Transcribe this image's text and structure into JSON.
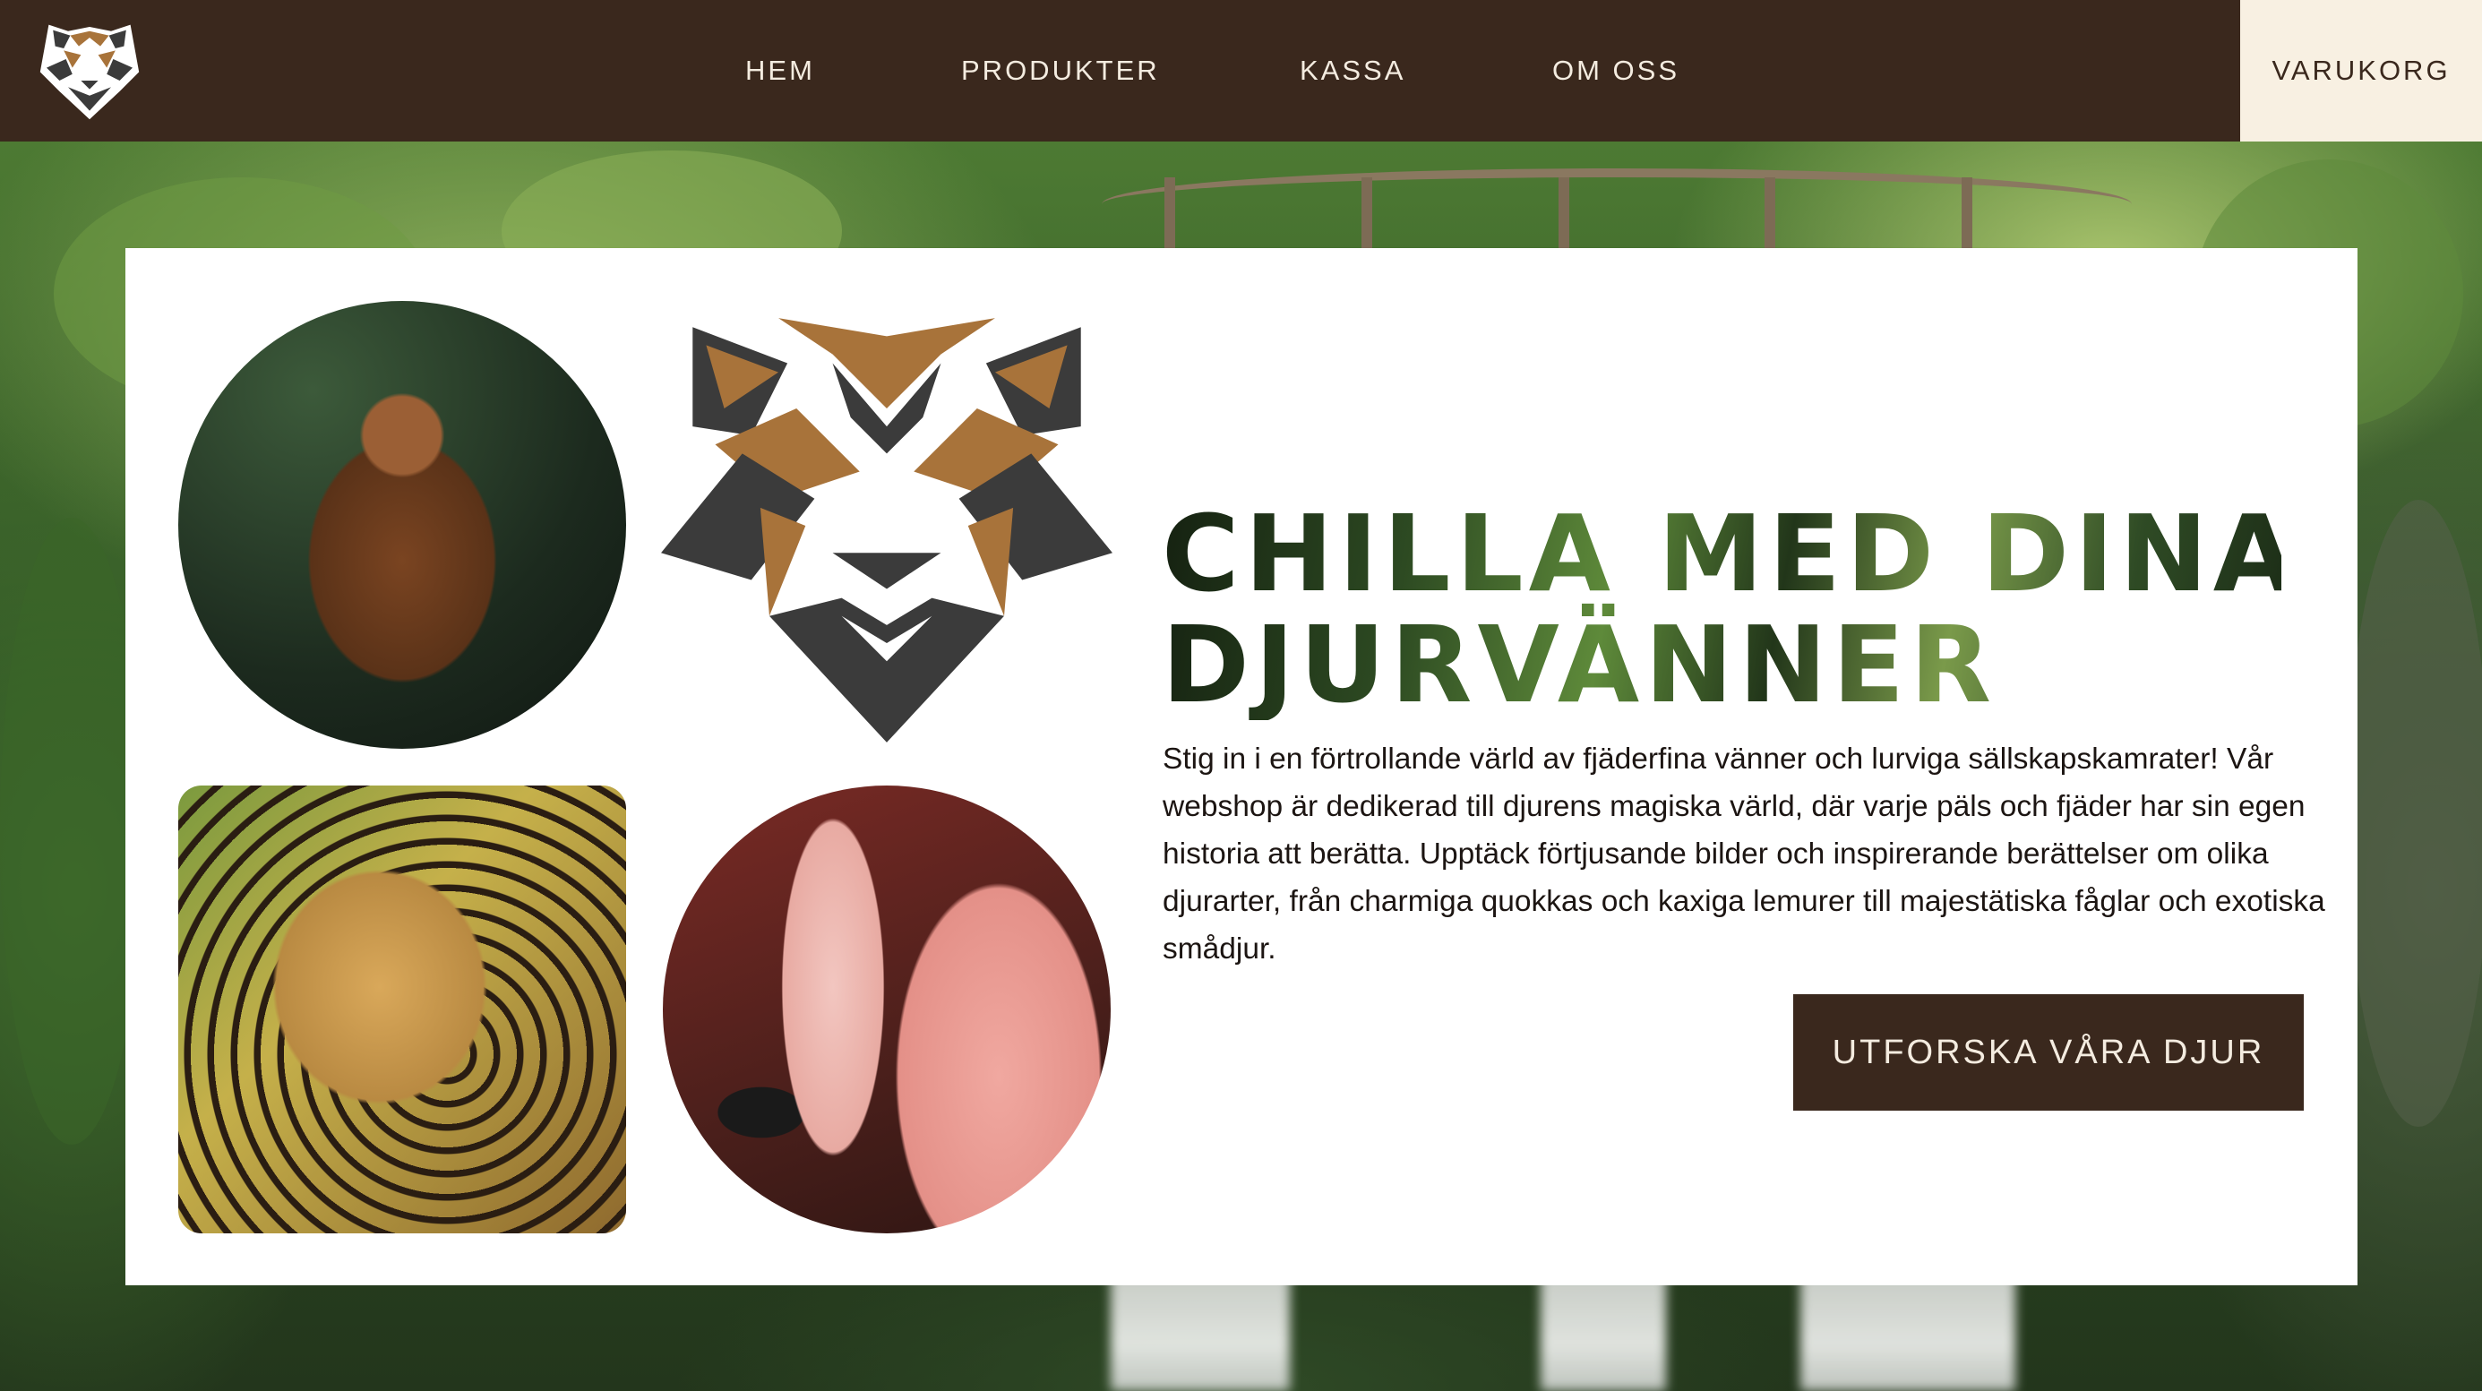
{
  "nav": {
    "items": [
      {
        "label": "HEM"
      },
      {
        "label": "PRODUKTER"
      },
      {
        "label": "KASSA"
      },
      {
        "label": "OM OSS"
      }
    ],
    "cart_label": "VARUKORG"
  },
  "hero": {
    "headline_line1": "CHILLA MED DINA",
    "headline_line2": "DJURVÄNNER",
    "body": "Stig in i en förtrollande värld av fjäderfina vänner och lurviga sällskapskamrater! Vår webshop är dedikerad till djurens magiska värld, där varje päls och fjäder har sin egen historia att berätta. Upptäck förtjusande bilder och inspirerande berättelser om olika djurarter, från charmiga quokkas och kaxiga lemurer till majestätiska fåglar och exotiska smådjur.",
    "cta_label": "UTFORSKA VÅRA DJUR"
  },
  "colors": {
    "header_bg": "#3a281d",
    "cart_bg": "#f8f0e2",
    "accent_brown": "#a8733a",
    "dark_gray": "#3b3b3b"
  },
  "icons": {
    "logo": "tiger-head-logo"
  }
}
